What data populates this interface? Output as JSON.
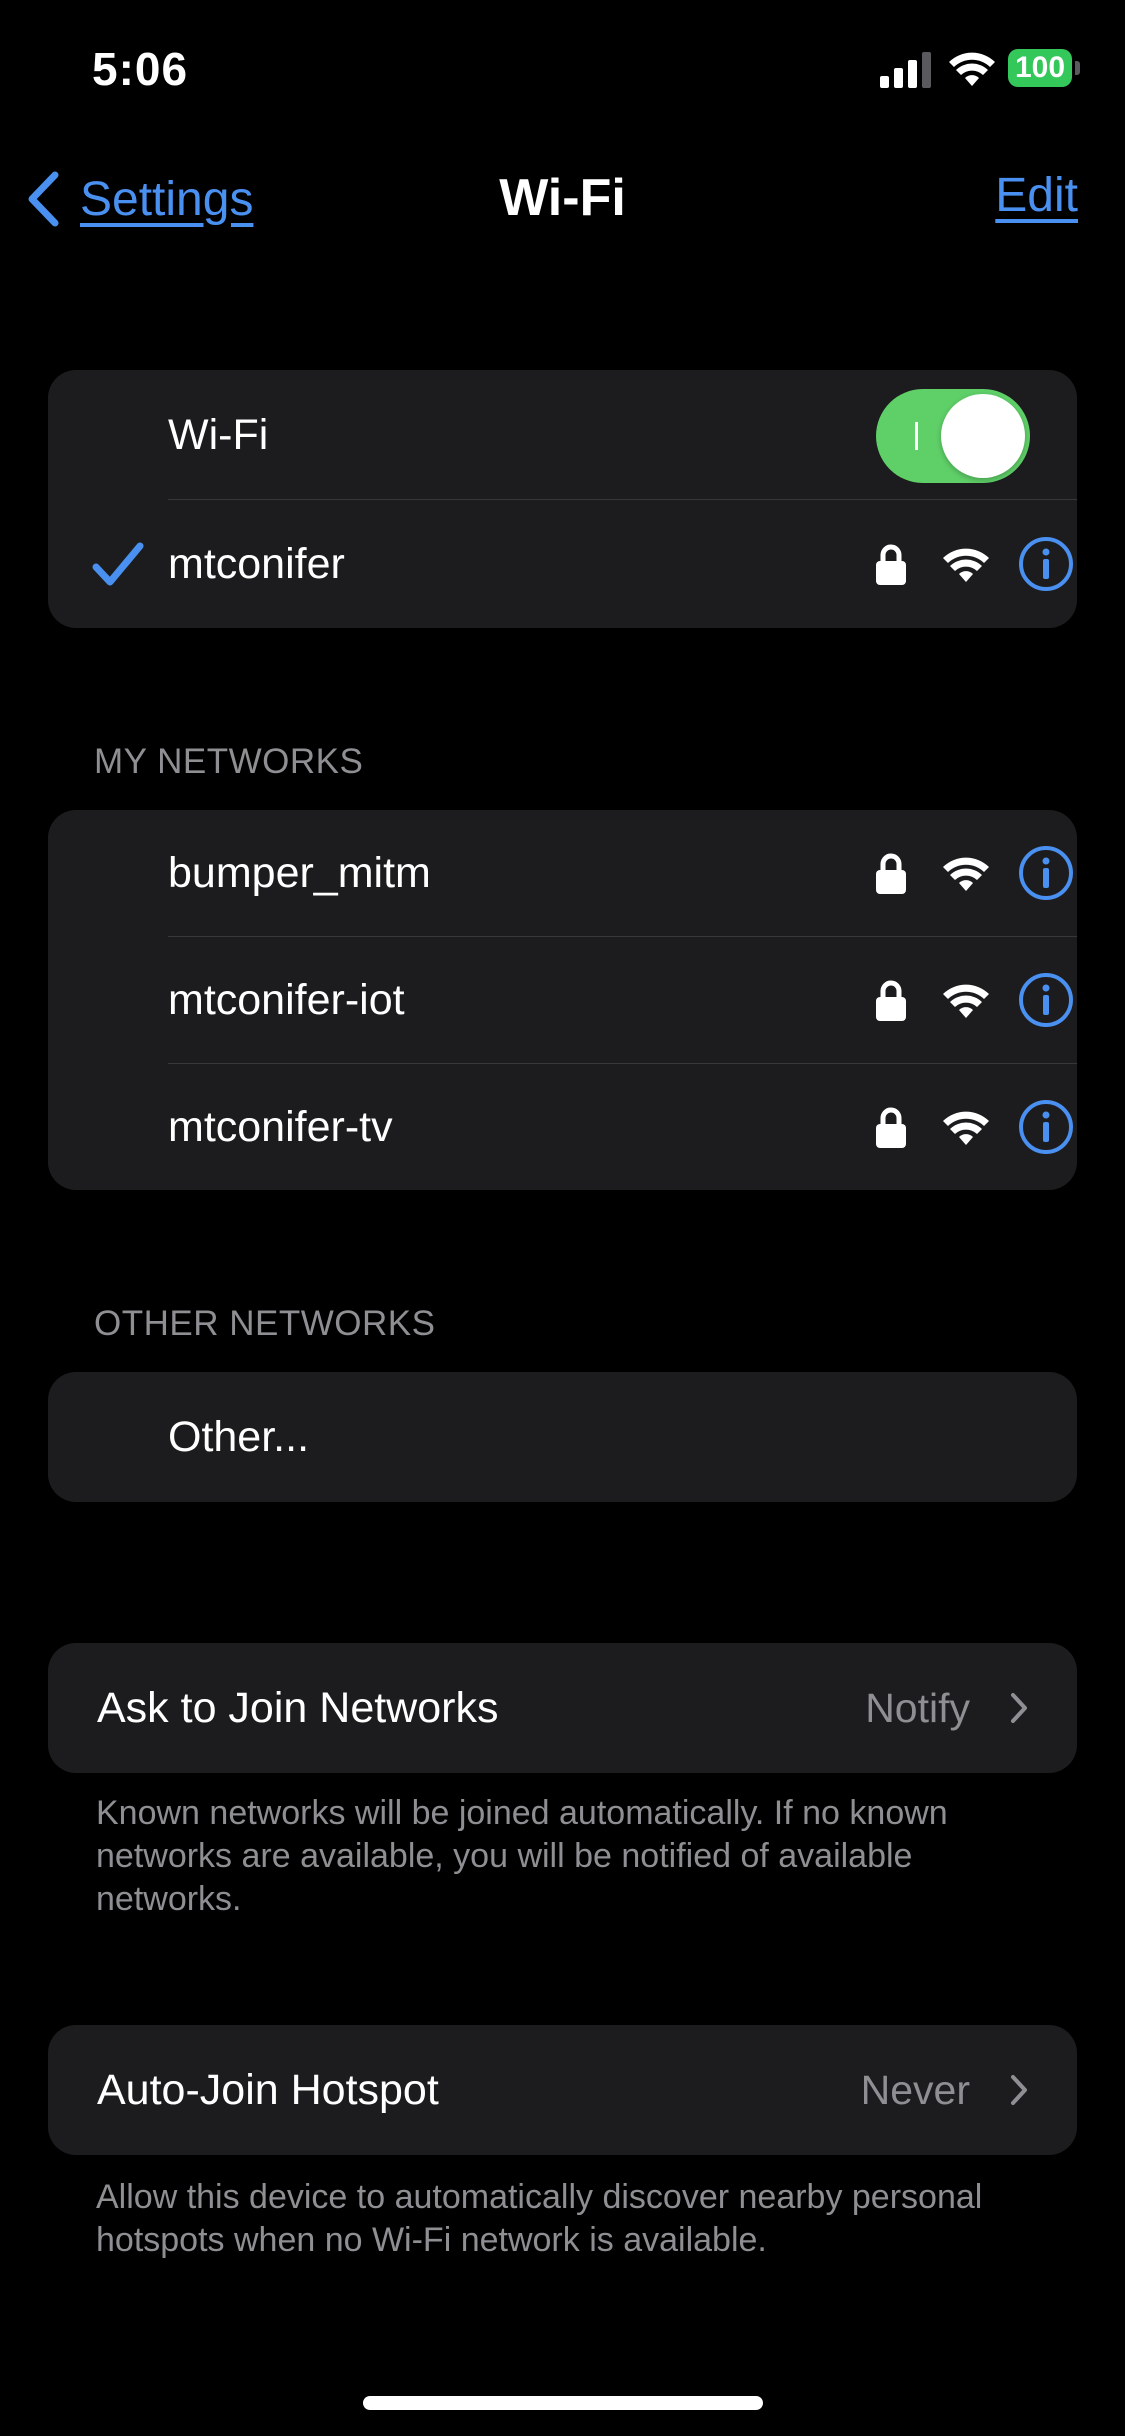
{
  "status_bar": {
    "time": "5:06",
    "battery": "100",
    "battery_color": "#34c759"
  },
  "nav": {
    "back_label": "Settings",
    "title": "Wi-Fi",
    "edit_label": "Edit"
  },
  "wifi_card": {
    "toggle_label": "Wi-Fi",
    "toggle_on": true,
    "current_network": "mtconifer"
  },
  "my_networks": {
    "header": "MY NETWORKS",
    "items": [
      {
        "name": "bumper_mitm"
      },
      {
        "name": "mtconifer-iot"
      },
      {
        "name": "mtconifer-tv"
      }
    ]
  },
  "other_networks": {
    "header": "OTHER NETWORKS",
    "other_label": "Other..."
  },
  "ask_to_join": {
    "label": "Ask to Join Networks",
    "value": "Notify",
    "note": "Known networks will be joined automatically. If no known networks are available, you will be notified of available networks."
  },
  "auto_join": {
    "label": "Auto-Join Hotspot",
    "value": "Never",
    "note": "Allow this device to automatically discover nearby personal hotspots when no Wi-Fi network is available."
  },
  "colors": {
    "accent": "#4a90f0",
    "toggle_on": "#5fd068",
    "card_bg": "#1c1c1e",
    "secondary_text": "#8e8e93"
  }
}
